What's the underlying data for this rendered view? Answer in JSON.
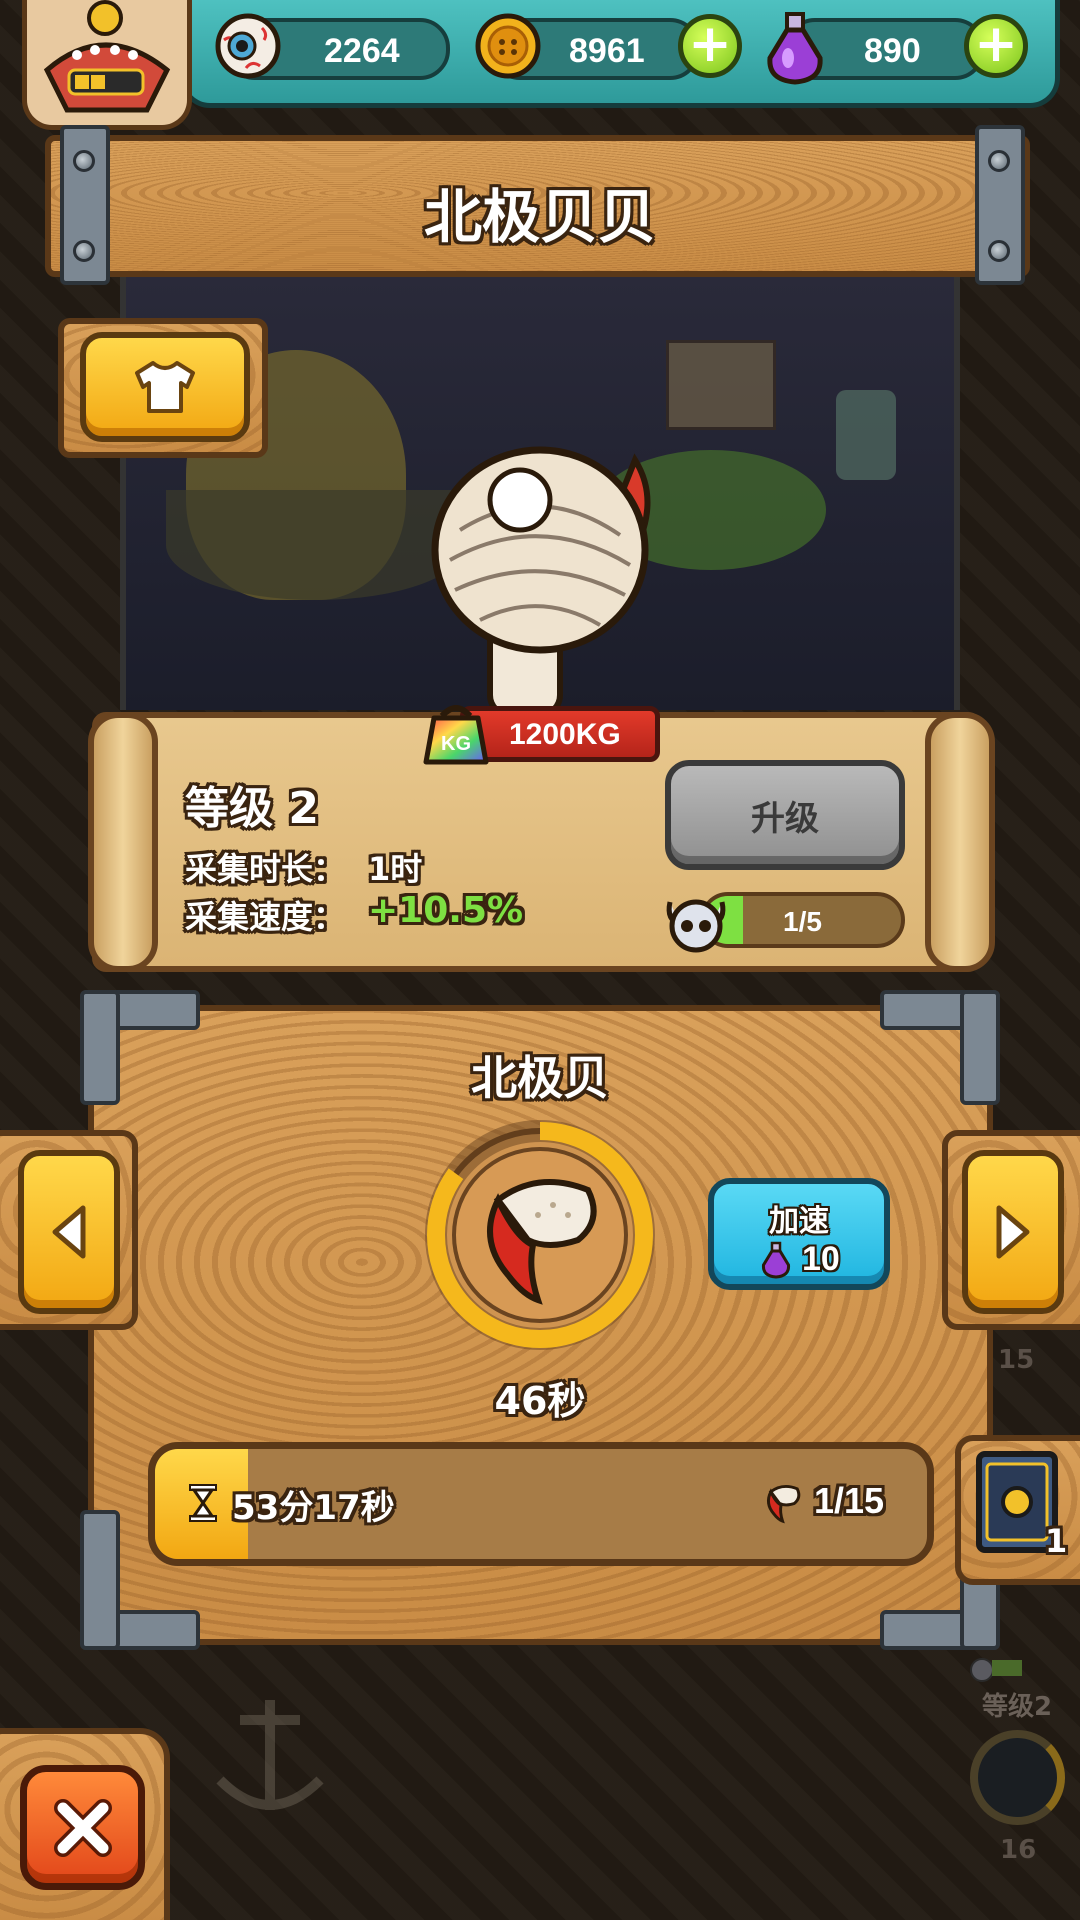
{
  "resources": {
    "eyeball": {
      "value": "2264",
      "icon": "eyeball-icon"
    },
    "coin": {
      "value": "8961",
      "icon": "coin-icon"
    },
    "potion": {
      "value": "890",
      "icon": "potion-icon"
    }
  },
  "header": {
    "title": "北极贝贝"
  },
  "pet": {
    "weight": "1200KG"
  },
  "stats": {
    "level_label": "等级 2",
    "duration_label": "采集时长：",
    "duration_value": "1时",
    "speed_label": "采集速度：",
    "speed_value": "+10.5%",
    "upgrade_label": "升级",
    "progress_text": "1/5",
    "progress_fraction": 0.2
  },
  "collect": {
    "title": "北极贝",
    "timer": "46秒",
    "ring_fraction": 0.85,
    "speed_up_label": "加速",
    "speed_up_cost": "10",
    "total_time": "53分17秒",
    "count": "1/15",
    "bar_fraction": 0.12
  },
  "side": {
    "num_top": "15",
    "book_count": "1",
    "level_label": "等级2",
    "num_bottom": "16"
  },
  "colors": {
    "green_text": "#7ee042",
    "cyan_btn": "#2fc7ea",
    "close_btn": "#f25a17"
  }
}
